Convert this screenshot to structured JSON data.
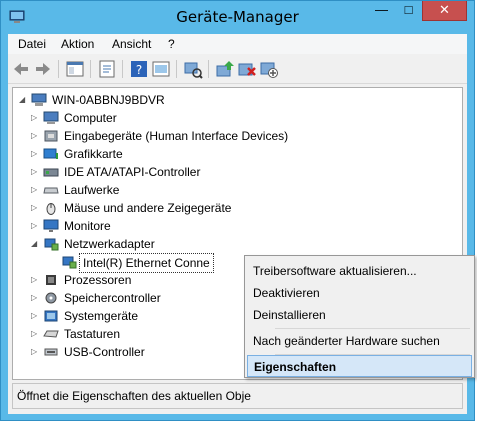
{
  "window": {
    "title": "Geräte-Manager",
    "minimize_glyph": "—",
    "maximize_glyph": "□",
    "close_glyph": "✕"
  },
  "menu": [
    "Datei",
    "Aktion",
    "Ansicht",
    "?"
  ],
  "toolbar_icons": [
    "back-arrow-icon",
    "forward-arrow-icon",
    "show-hide-console-tree-icon",
    "properties-icon",
    "help-icon",
    "show-device-icon",
    "update-driver-icon",
    "disable-device-icon",
    "uninstall-device-icon",
    "scan-hardware-icon"
  ],
  "tree": {
    "root": "WIN-0ABBNJ9BDVR",
    "categories": [
      {
        "label": "Computer",
        "expanded": false
      },
      {
        "label": "Eingabegeräte (Human Interface Devices)",
        "expanded": false
      },
      {
        "label": "Grafikkarte",
        "expanded": false
      },
      {
        "label": "IDE ATA/ATAPI-Controller",
        "expanded": false
      },
      {
        "label": "Laufwerke",
        "expanded": false
      },
      {
        "label": "Mäuse und andere Zeigegeräte",
        "expanded": false
      },
      {
        "label": "Monitore",
        "expanded": false
      },
      {
        "label": "Netzwerkadapter",
        "expanded": true
      },
      {
        "label": "Prozessoren",
        "expanded": false
      },
      {
        "label": "Speichercontroller",
        "expanded": false
      },
      {
        "label": "Systemgeräte",
        "expanded": false
      },
      {
        "label": "Tastaturen",
        "expanded": false
      },
      {
        "label": "USB-Controller",
        "expanded": false
      }
    ],
    "selected_child": "Intel(R) Ethernet Conne"
  },
  "status": "Öffnet die Eigenschaften des aktuellen Obje",
  "context_menu": {
    "items": [
      "Treibersoftware aktualisieren...",
      "Deaktivieren",
      "Deinstallieren",
      "Nach geänderter Hardware suchen",
      "Eigenschaften"
    ],
    "highlighted": "Eigenschaften"
  },
  "colors": {
    "title_bar": "#59b9e8",
    "close_button": "#c7504f",
    "highlight": "#d5e7f8"
  }
}
